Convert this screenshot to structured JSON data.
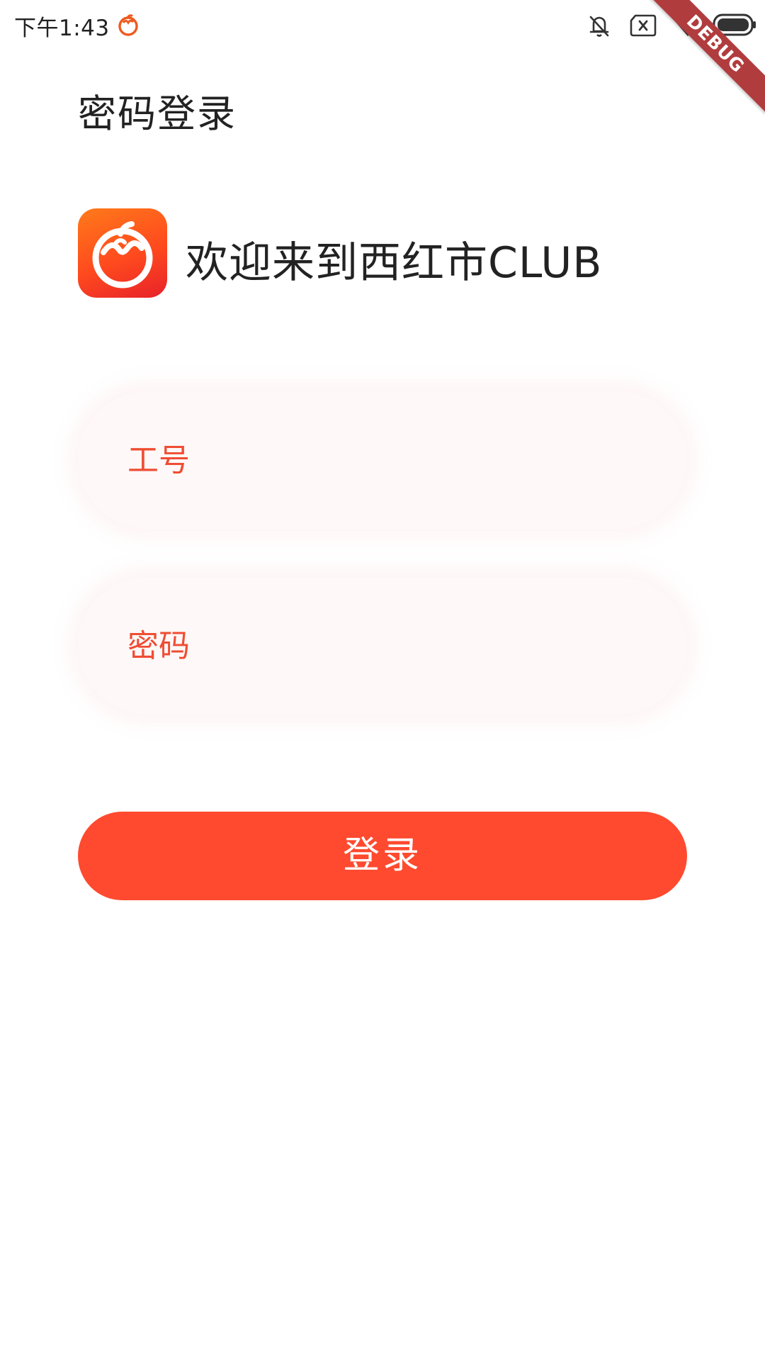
{
  "status_bar": {
    "time": "下午1:43",
    "app_icon": "tomato-icon",
    "icons": [
      "bell-off-icon",
      "sim-x-icon",
      "wifi-icon",
      "battery-icon"
    ]
  },
  "debug_banner": {
    "label": "DEBUG",
    "color": "#b13c3e"
  },
  "page": {
    "title": "密码登录"
  },
  "welcome": {
    "logo_icon": "tomato-logo-icon",
    "text": "欢迎来到西红市CLUB"
  },
  "form": {
    "employee_id": {
      "placeholder": "工号",
      "value": ""
    },
    "password": {
      "placeholder": "密码",
      "value": ""
    },
    "login_label": "登录"
  },
  "colors": {
    "accent": "#ff4a2f",
    "placeholder": "#ef4d33",
    "field_background": "#fef8f8",
    "text": "#222222"
  }
}
